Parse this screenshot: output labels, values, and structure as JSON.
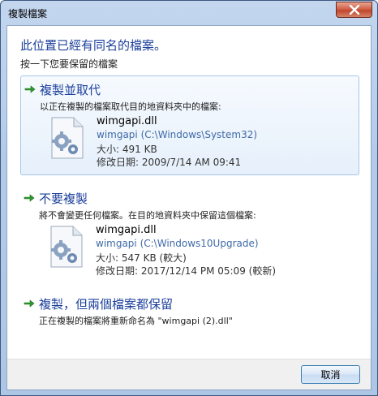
{
  "window": {
    "title": "複製檔案"
  },
  "header": {
    "title": "此位置已經有同名的檔案。",
    "subtitle": "按一下您要保留的檔案"
  },
  "options": [
    {
      "title": "複製並取代",
      "description": "以正在複製的檔案取代目的地資料夾中的檔案:",
      "file": {
        "name": "wimgapi.dll",
        "path": "wimgapi (C:\\Windows\\System32)",
        "size": "大小: 491 KB",
        "modified": "修改日期: 2009/7/14 AM 09:41"
      }
    },
    {
      "title": "不要複製",
      "description": "將不會變更任何檔案。在目的地資料夾中保留這個檔案:",
      "file": {
        "name": "wimgapi.dll",
        "path": "wimgapi (C:\\Windows10Upgrade)",
        "size": "大小: 547 KB (較大)",
        "modified": "修改日期: 2017/12/14 PM 05:09 (較新)"
      }
    },
    {
      "title": "複製，但兩個檔案都保留",
      "description": "正在複製的檔案將重新命名為 \"wimgapi (2).dll\""
    }
  ],
  "footer": {
    "cancel_label": "取消"
  },
  "icons": {
    "arrow": "green-arrow-icon",
    "file": "dll-file-icon",
    "close": "close-icon"
  },
  "colors": {
    "link_blue": "#1b3f9c",
    "path_blue": "#3f6aa8",
    "arrow_green": "#2f9a2f",
    "close_red": "#c7432a"
  }
}
